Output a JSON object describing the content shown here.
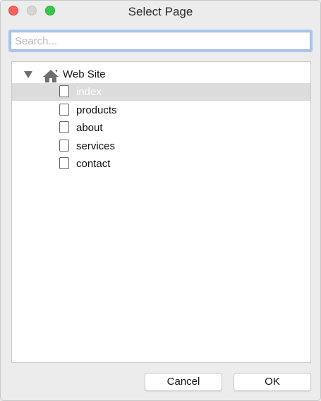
{
  "window": {
    "title": "Select Page"
  },
  "search": {
    "placeholder": "Search...",
    "value": ""
  },
  "tree": {
    "root": {
      "label": "Web Site",
      "icon": "home-icon",
      "expanded": true
    },
    "pages": [
      {
        "label": "index",
        "icon": "page-icon",
        "selected": true
      },
      {
        "label": "products",
        "icon": "page-icon",
        "selected": false
      },
      {
        "label": "about",
        "icon": "page-icon",
        "selected": false
      },
      {
        "label": "services",
        "icon": "page-icon",
        "selected": false
      },
      {
        "label": "contact",
        "icon": "page-icon",
        "selected": false
      }
    ]
  },
  "buttons": {
    "cancel": "Cancel",
    "ok": "OK"
  },
  "colors": {
    "close": "#fc605c",
    "minimize": "#d6d6d6",
    "zoom": "#34c84a",
    "selection": "#dcdcdc",
    "search_focus": "#a9c6ee"
  }
}
